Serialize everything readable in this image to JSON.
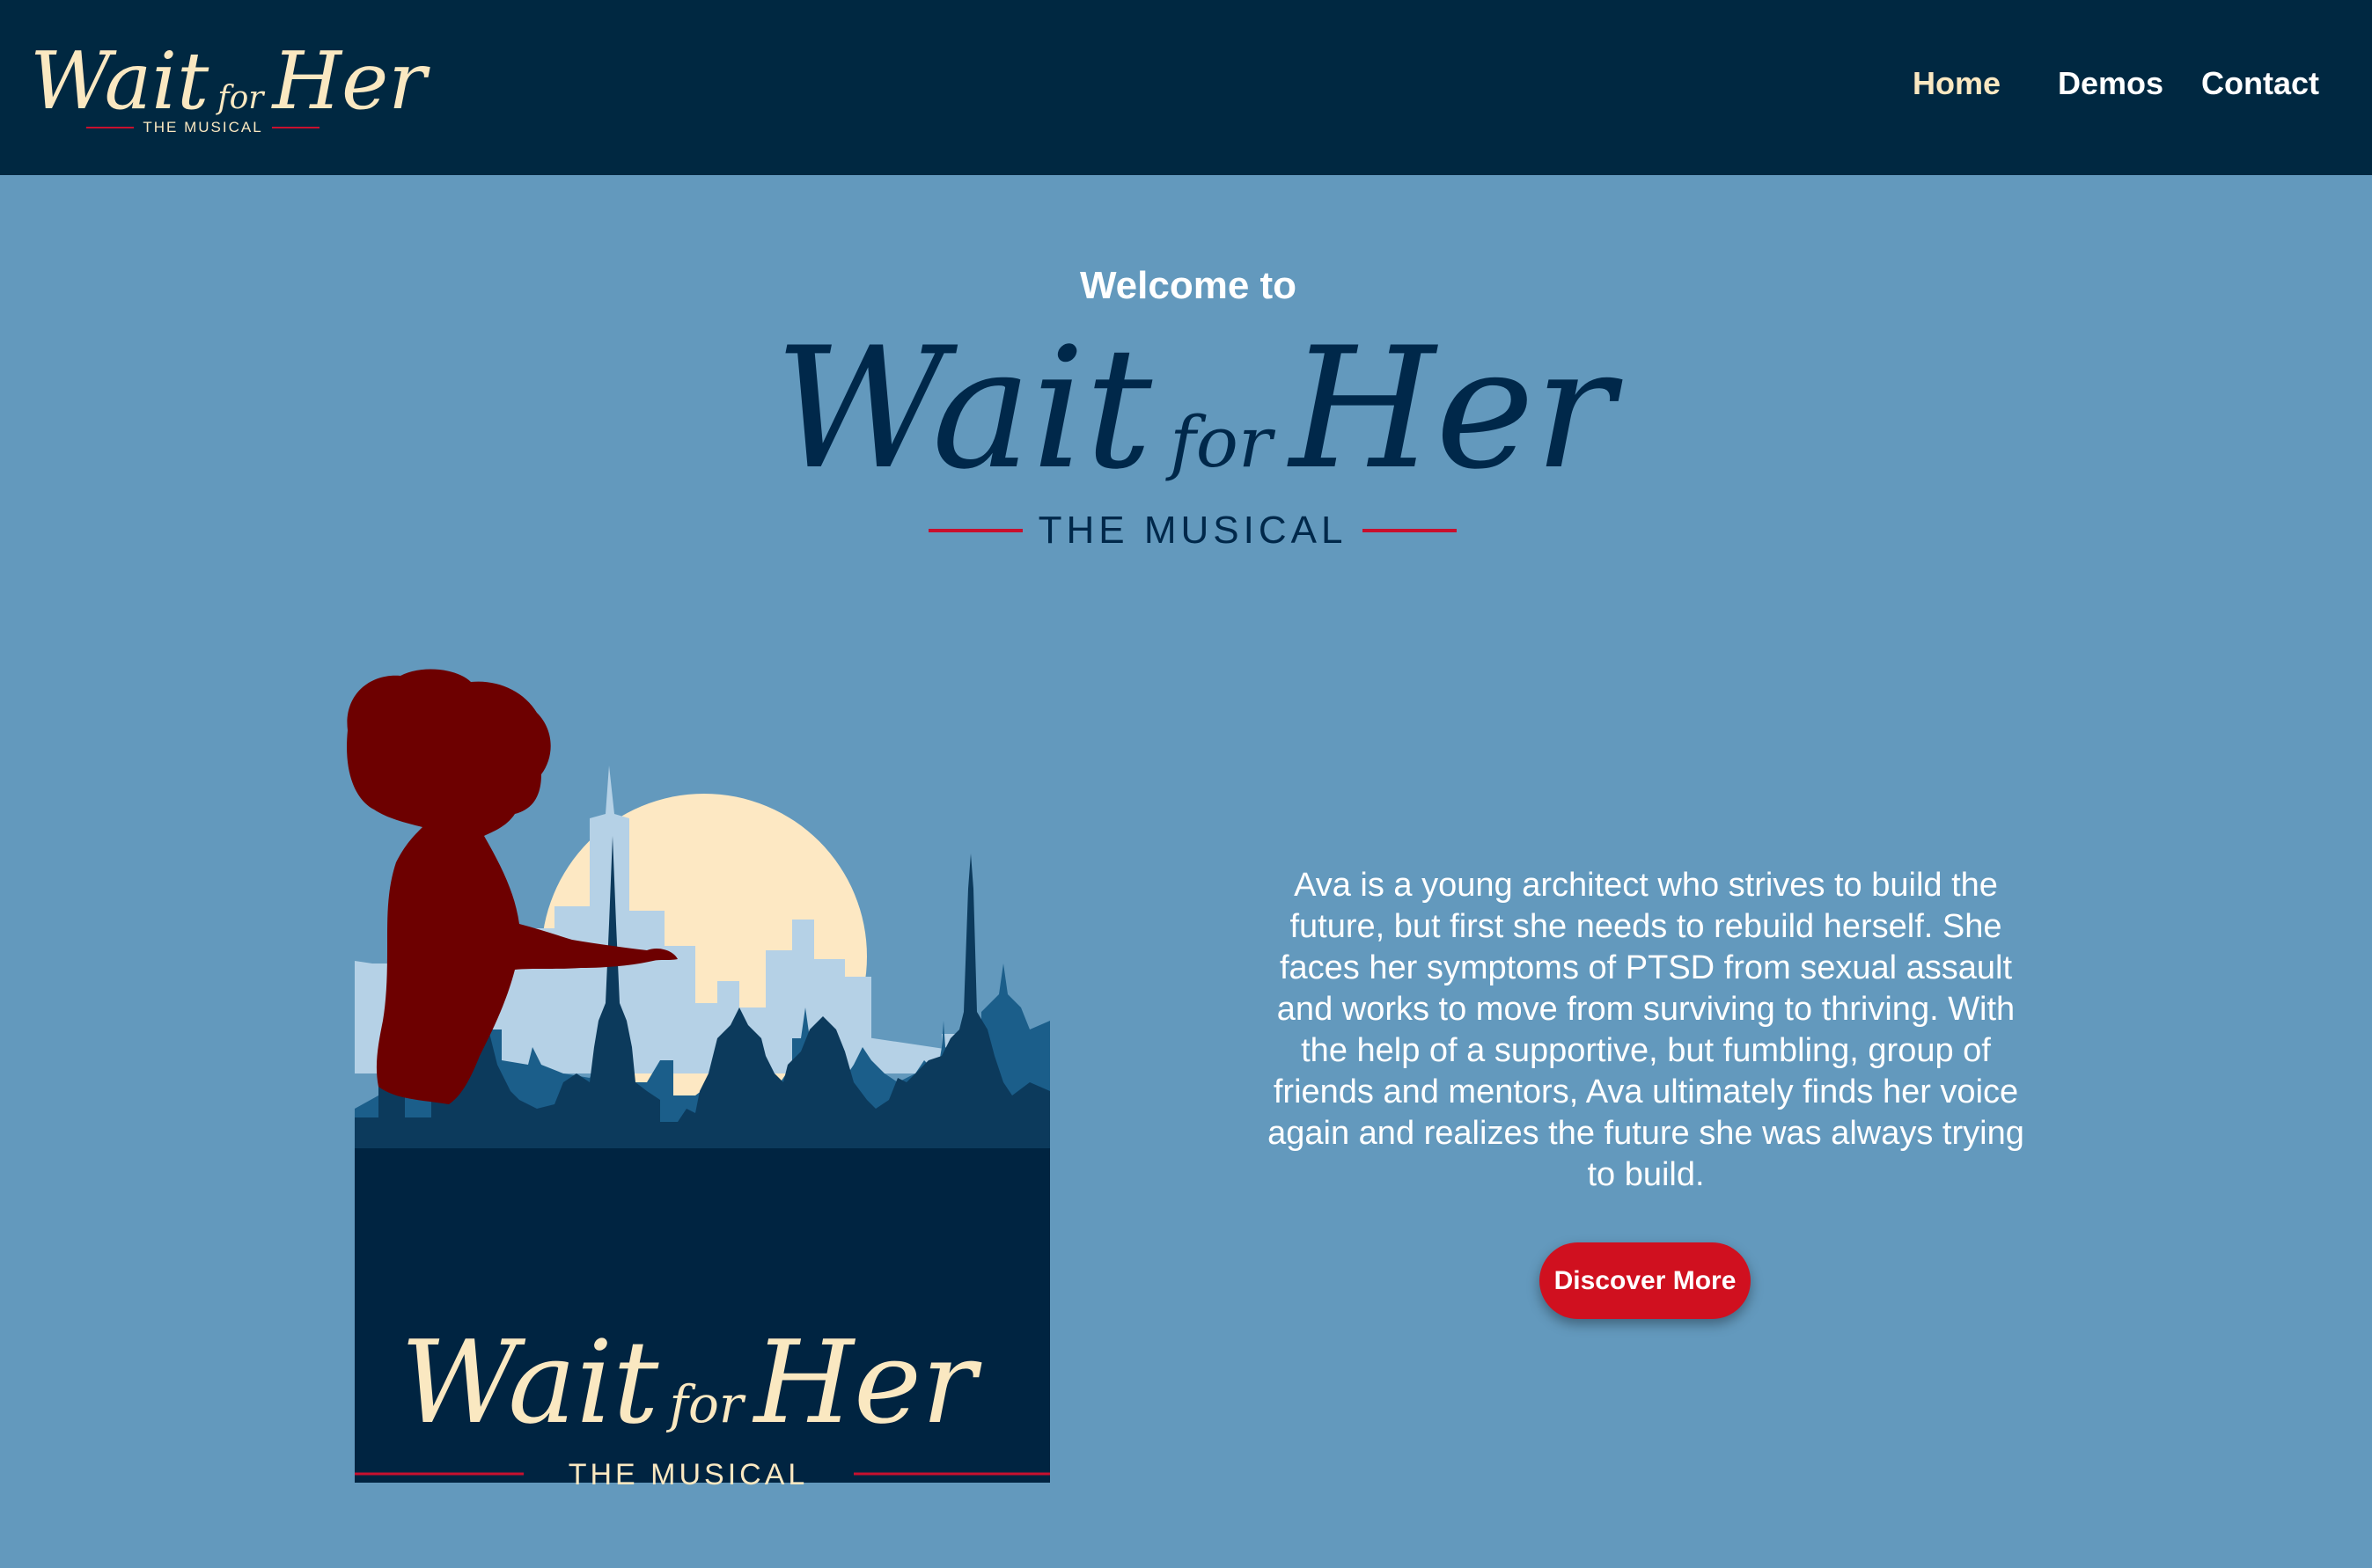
{
  "header": {
    "logo": {
      "title_start": "Wait",
      "title_mid": "for",
      "title_end": "Her",
      "subtitle": "THE MUSICAL"
    },
    "nav": [
      {
        "label": "Home",
        "active": true
      },
      {
        "label": "Demos",
        "active": false
      },
      {
        "label": "Contact",
        "active": false
      }
    ]
  },
  "hero": {
    "welcome": "Welcome to",
    "title_start": "Wait",
    "title_mid": "for",
    "title_end": "Her",
    "subtitle": "THE MUSICAL"
  },
  "poster": {
    "title_start": "Wait",
    "title_mid": "for",
    "title_end": "Her",
    "subtitle": "THE MUSICAL"
  },
  "main": {
    "description": "Ava is a young architect who strives to build the future, but first she needs to rebuild herself. She faces her symptoms of PTSD from sexual assault and works to move from surviving to thriving. With the help of a supportive, but fumbling, group of friends and mentors, Ava ultimately finds her voice again and realizes the future she was always trying to build.",
    "cta_label": "Discover More"
  },
  "colors": {
    "header_bg": "#002841",
    "page_bg": "#6399bd",
    "cream": "#fae8c1",
    "navy": "#00284a",
    "accent_red": "#c8102e",
    "button_red": "#d0101f"
  }
}
